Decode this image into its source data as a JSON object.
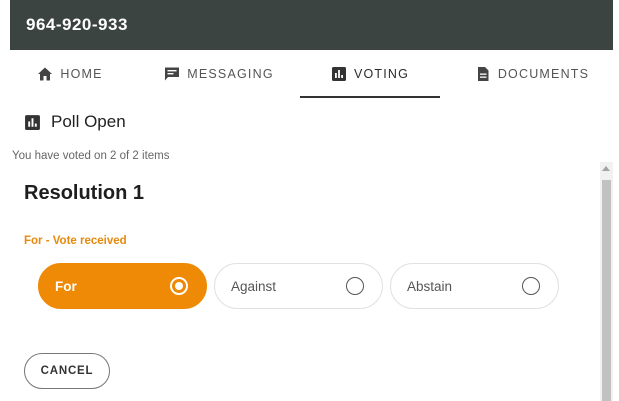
{
  "header": {
    "title": "964-920-933"
  },
  "tabs": [
    {
      "label": "HOME",
      "icon": "home-icon",
      "active": false
    },
    {
      "label": "MESSAGING",
      "icon": "chat-icon",
      "active": false
    },
    {
      "label": "VOTING",
      "icon": "chart-icon",
      "active": true
    },
    {
      "label": "DOCUMENTS",
      "icon": "document-icon",
      "active": false
    }
  ],
  "poll": {
    "title": "Poll Open",
    "icon": "chart-icon",
    "vote_count": "You have voted on 2 of 2 items"
  },
  "resolution": {
    "title": "Resolution 1",
    "status": "For - Vote received",
    "status_color": "#e8890c",
    "options": [
      {
        "label": "For",
        "selected": true
      },
      {
        "label": "Against",
        "selected": false
      },
      {
        "label": "Abstain",
        "selected": false
      }
    ],
    "accent_color": "#ee8a05"
  },
  "actions": {
    "cancel_label": "CANCEL"
  },
  "colors": {
    "header_bg": "#3b4440"
  }
}
